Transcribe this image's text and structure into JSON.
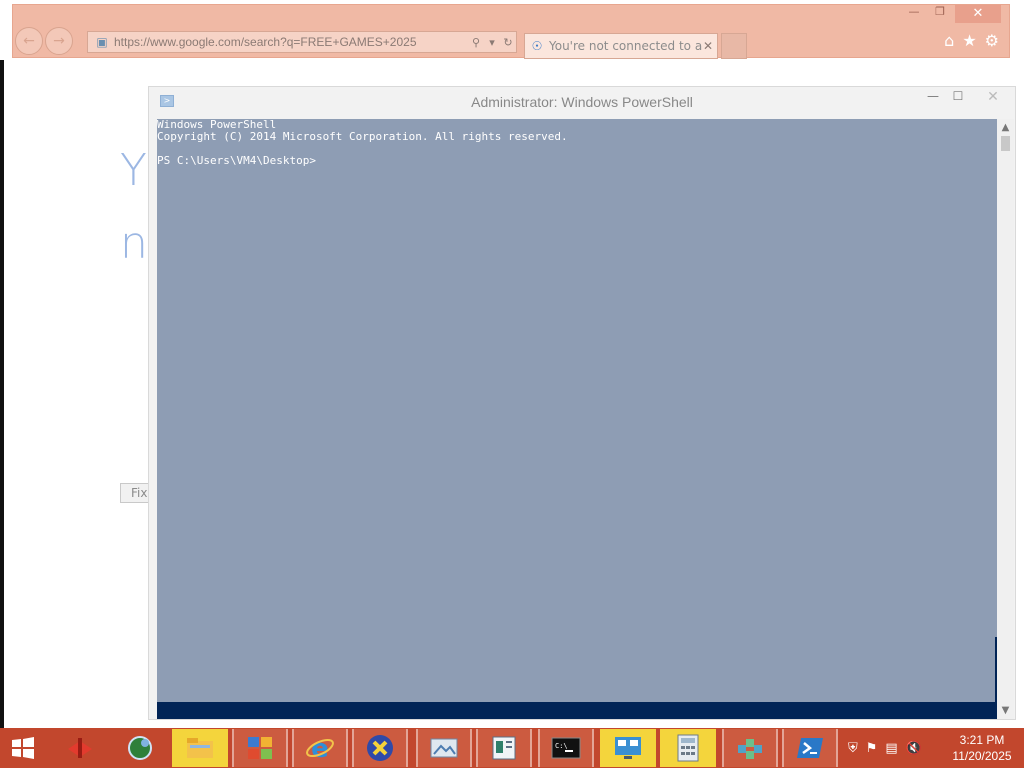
{
  "browser": {
    "address_url": "https://www.google.com/search?q=FREE+GAMES+2025",
    "tab_label": "You're not connected to a ...",
    "page_letter_1": "Y",
    "page_letter_2": "n",
    "fix_button_label": "Fix",
    "icons": [
      "back-icon",
      "forward-icon",
      "home-icon",
      "favorites-star-icon",
      "settings-gear-icon"
    ]
  },
  "powershell": {
    "title": "Administrator: Windows PowerShell",
    "console_lines": "Windows PowerShell\nCopyright (C) 2014 Microsoft Corporation. All rights reserved.\n\nPS C:\\Users\\VM4\\Desktop>",
    "colors": {
      "console_bg": "#8e9db4",
      "console_footer": "#012456"
    }
  },
  "taskbar": {
    "colors": {
      "bar": "#c2472d",
      "active_app": "#f4d53c"
    },
    "apps": [
      {
        "name": "red-app-icon"
      },
      {
        "name": "globe-app-icon"
      },
      {
        "name": "file-explorer-icon"
      },
      {
        "name": "control-panel-icon"
      },
      {
        "name": "internet-explorer-icon"
      },
      {
        "name": "x-app-icon"
      },
      {
        "name": "photo-viewer-icon"
      },
      {
        "name": "form-app-icon"
      },
      {
        "name": "command-prompt-icon"
      },
      {
        "name": "network-app-icon"
      },
      {
        "name": "calculator-icon"
      },
      {
        "name": "registry-editor-icon"
      },
      {
        "name": "powershell-icon"
      }
    ],
    "time": "3:21 PM",
    "date": "11/20/2025"
  }
}
